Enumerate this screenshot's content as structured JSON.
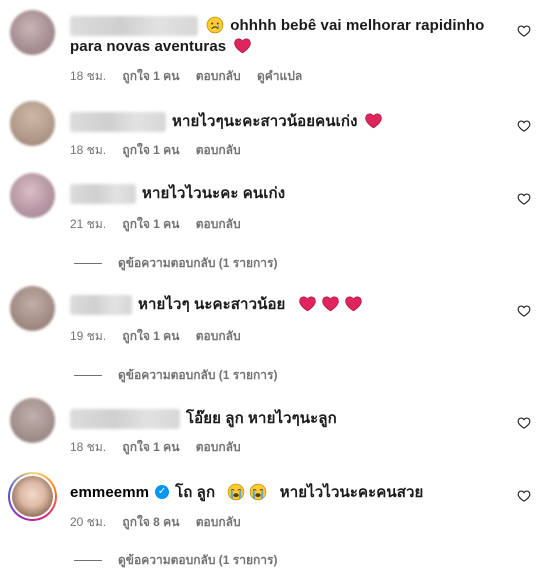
{
  "comments": [
    {
      "text": "ohhhh bebê vai melhorar rapidinho para novas aventuras",
      "time": "18 ชม.",
      "likes": "ถูกใจ 1 คน",
      "reply": "ตอบกลับ",
      "translate": "ดูคำแปล"
    },
    {
      "text": "หายไวๆนะคะสาวน้อยคนเก่ง",
      "time": "18 ชม.",
      "likes": "ถูกใจ 1 คน",
      "reply": "ตอบกลับ"
    },
    {
      "text": "หายไวไวนะคะ คนเก่ง",
      "time": "21 ชม.",
      "likes": "ถูกใจ 1 คน",
      "reply": "ตอบกลับ",
      "view_replies": "ดูข้อความตอบกลับ (1 รายการ)"
    },
    {
      "text": "หายไวๆ นะคะสาวน้อย",
      "time": "19 ชม.",
      "likes": "ถูกใจ 1 คน",
      "reply": "ตอบกลับ",
      "view_replies": "ดูข้อความตอบกลับ (1 รายการ)"
    },
    {
      "text": "โอ๊ยย ลูก หายไวๆนะลูก",
      "time": "18 ชม.",
      "likes": "ถูกใจ 1 คน",
      "reply": "ตอบกลับ"
    },
    {
      "username": "emmeemm",
      "text_a": "โถ ลูก",
      "text_b": "หายไวไวนะคะคนสวย",
      "time": "20 ชม.",
      "likes": "ถูกใจ 8 คน",
      "reply": "ตอบกลับ",
      "view_replies": "ดูข้อความตอบกลับ (1 รายการ)"
    }
  ],
  "icons": {
    "heart_outline": "heart-outline-icon",
    "red_heart": "red-heart-icon",
    "sad_face": "sad-face-icon",
    "crying_face": "crying-face-icon",
    "verified": "verified-badge-icon"
  },
  "colors": {
    "meta_text": "#737373",
    "red_heart": "#e0245e",
    "verified": "#0095f6"
  }
}
